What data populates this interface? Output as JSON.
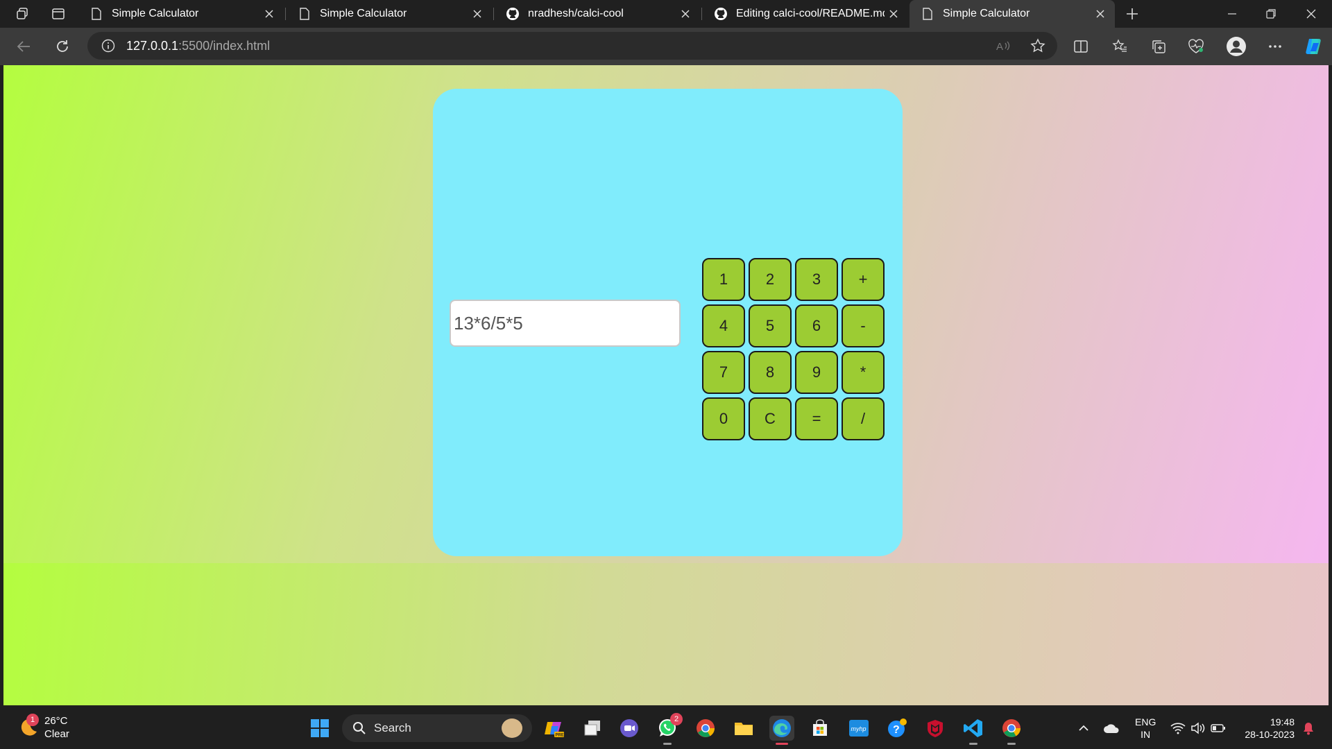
{
  "browser": {
    "tabs": [
      {
        "title": "Simple Calculator",
        "favicon": "page-icon"
      },
      {
        "title": "Simple Calculator",
        "favicon": "page-icon"
      },
      {
        "title": "nradhesh/calci-cool",
        "favicon": "github-icon"
      },
      {
        "title": "Editing calci-cool/README.md at",
        "favicon": "github-icon"
      },
      {
        "title": "Simple Calculator",
        "favicon": "page-icon",
        "active": true
      }
    ],
    "address": {
      "host": "127.0.0.1",
      "rest": ":5500/index.html"
    }
  },
  "calculator": {
    "display_value": "13*6/5*5",
    "keys": [
      "1",
      "2",
      "3",
      "+",
      "4",
      "5",
      "6",
      "-",
      "7",
      "8",
      "9",
      "*",
      "0",
      "C",
      "=",
      "/"
    ],
    "colors": {
      "panel": "#80ecfc",
      "key": "#9ccc33"
    }
  },
  "taskbar": {
    "weather": {
      "temp": "26°C",
      "condition": "Clear",
      "badge": "1"
    },
    "search_label": "Search",
    "whatsapp_badge": "2",
    "lang": {
      "line1": "ENG",
      "line2": "IN"
    },
    "time": "19:48",
    "date": "28-10-2023"
  }
}
